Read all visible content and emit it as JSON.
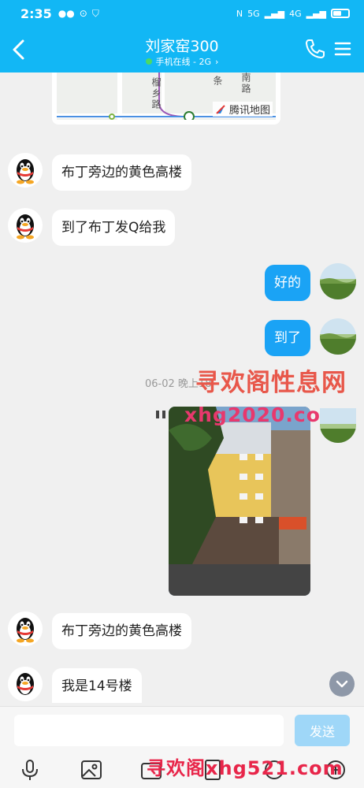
{
  "status_bar": {
    "time": "2:35",
    "signal_1": "5G",
    "signal_2": "4G",
    "battery_level": 0.55
  },
  "header": {
    "title": "刘家窑300",
    "subtitle": "手机在线 - 2G",
    "subtitle_chevron": "›"
  },
  "map": {
    "streets": [
      "榴乡路",
      "条",
      "南路"
    ],
    "brand": "腾讯地图"
  },
  "messages": [
    {
      "from": "other",
      "text": "布丁旁边的黄色高楼"
    },
    {
      "from": "other",
      "text": "到了布丁发Q给我"
    },
    {
      "from": "me",
      "text": "好的"
    },
    {
      "from": "me",
      "text": "到了"
    },
    {
      "from": "other",
      "text": "布丁旁边的黄色高楼"
    },
    {
      "from": "other",
      "text": "我是14号楼"
    }
  ],
  "timestamp": "06-02 晚上1",
  "timestamp_tail": "8",
  "watermarks": {
    "top_cn": "寻欢阁性息网",
    "top_url": "xhg2020.com",
    "bottom": "寻欢阁xhg521.com"
  },
  "input": {
    "value": "",
    "send_label": "发送"
  },
  "colors": {
    "header": "#12b7f5",
    "bubble_out": "#1aa3f5",
    "send_disabled": "#9fd7f8"
  },
  "toolbar_icons": [
    "microphone-icon",
    "image-icon",
    "camera-icon",
    "red-packet-icon",
    "emoji-icon",
    "plus-icon"
  ]
}
